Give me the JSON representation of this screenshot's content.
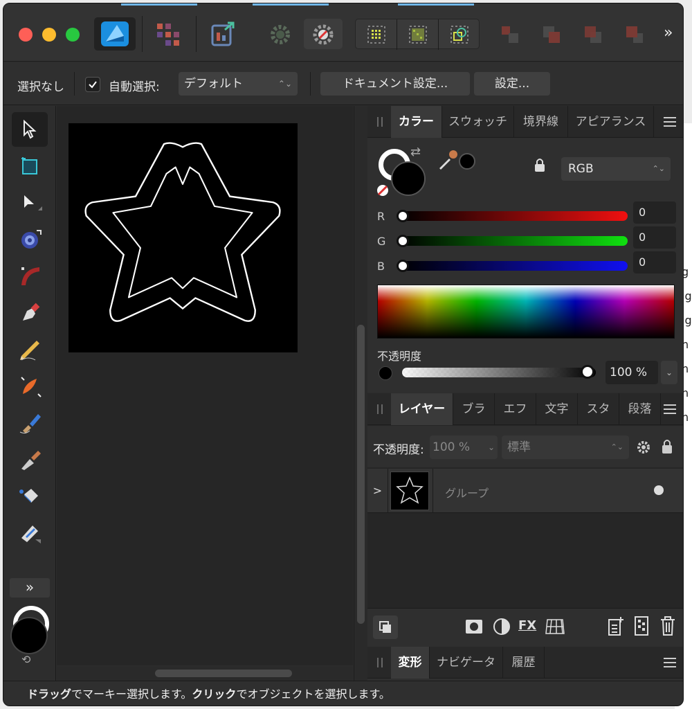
{
  "context_bar": {
    "selection_label": "選択なし",
    "auto_select_label": "自動選択:",
    "auto_select_value": "デフォルト",
    "document_settings_button": "ドキュメント設定...",
    "settings_button": "設定..."
  },
  "color_panel": {
    "tabs": [
      "カラー",
      "スウォッチ",
      "境界線",
      "アピアランス"
    ],
    "active_tab": "カラー",
    "model": "RGB",
    "r_label": "R",
    "r_value": "0",
    "g_label": "G",
    "g_value": "0",
    "b_label": "B",
    "b_value": "0",
    "opacity_label": "不透明度",
    "opacity_value": "100 %",
    "fill_color": "#000000",
    "stroke_color": "#ffffff"
  },
  "layers_panel": {
    "tabs": [
      "レイヤー",
      "ブラ",
      "エフ",
      "文字",
      "スタ",
      "段落"
    ],
    "active_tab": "レイヤー",
    "opacity_label": "不透明度:",
    "opacity_value": "100 %",
    "blend_mode": "標準",
    "layers": [
      {
        "name": "グループ",
        "expand_glyph": ">"
      }
    ]
  },
  "bottom_panel": {
    "tabs": [
      "変形",
      "ナビゲータ",
      "履歴"
    ],
    "active_tab": "変形"
  },
  "status_bar": {
    "part1": "ドラッグ",
    "part2": "でマーキー選択します。",
    "part3": "クリック",
    "part4": "でオブジェクトを選択します。"
  },
  "toolbar_icons": [
    "affinity-designer-logo-icon",
    "persona-pixel-icon",
    "export-persona-icon",
    "gear-icon",
    "snapping-icon",
    "grid-select-icon",
    "grid-select-2-icon",
    "boolean-icon",
    "arrange-back-icon",
    "arrange-backward-icon",
    "arrange-forward-icon",
    "arrange-front-icon",
    "more-icon"
  ],
  "tools_more_glyph": "»",
  "background_text": [
    "g",
    "ig",
    "ig",
    "n",
    "n",
    "n",
    "n"
  ]
}
